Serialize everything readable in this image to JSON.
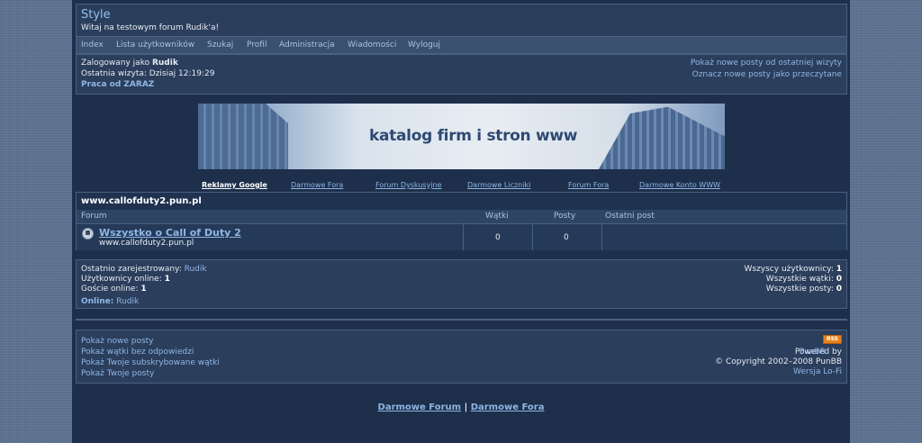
{
  "header": {
    "title": "Style",
    "description": "Witaj na testowym forum Rudik'a!"
  },
  "nav": [
    "Index",
    "Lista użytkowników",
    "Szukaj",
    "Profil",
    "Administracja",
    "Wiadomości",
    "Wyloguj"
  ],
  "status": {
    "logged_prefix": "Zalogowany jako",
    "logged_user": "Rudik",
    "last_visit": "Ostatnia wizyta: Dzisiaj 12:19:29",
    "job_link": "Praca od ZARAZ",
    "new_posts_link": "Pokaż nowe posty od ostatniej wizyty",
    "mark_read_link": "Oznacz nowe posty jako przeczytane"
  },
  "banner": {
    "text": "katalog firm i stron www"
  },
  "ad_links": [
    "Reklamy Google",
    "Darmowe Fora",
    "Forum Dyskusyjne",
    "Darmowe Liczniki",
    "Forum Fora",
    "Darmowe Konto WWW"
  ],
  "forum_box": {
    "title": "www.callofduty2.pun.pl",
    "columns": [
      "Forum",
      "Wątki",
      "Posty",
      "Ostatni post"
    ],
    "rows": [
      {
        "name": "Wszystko o Call of Duty 2",
        "description": "www.callofduty2.pun.pl",
        "threads": "0",
        "posts": "0",
        "last_post": ""
      }
    ]
  },
  "stats": {
    "last_registered_label": "Ostatnio zarejestrowany:",
    "last_registered_user": "Rudik",
    "users_online_label": "Użytkownicy online:",
    "users_online": "1",
    "guests_online_label": "Goście online:",
    "guests_online": "1",
    "online_label": "Online:",
    "online_user": "Rudik",
    "total_users_label": "Wszyscy użytkownicy:",
    "total_users": "1",
    "total_threads_label": "Wszystkie wątki:",
    "total_threads": "0",
    "total_posts_label": "Wszystkie posty:",
    "total_posts": "0"
  },
  "footer": {
    "links": [
      "Pokaż nowe posty",
      "Pokaż wątki bez odpowiedzi",
      "Pokaż Twoje subskrybowane wątki",
      "Pokaż Twoje posty"
    ],
    "rss": "RSS",
    "powered_label": "Powered by",
    "powered_link": "PunBB",
    "copyright": "© Copyright 2002–2008 PunBB",
    "lofi_link": "Wersja Lo-Fi"
  },
  "bottom_links": [
    "Darmowe Forum",
    "Darmowe Fora"
  ],
  "bottom_separator": "|"
}
